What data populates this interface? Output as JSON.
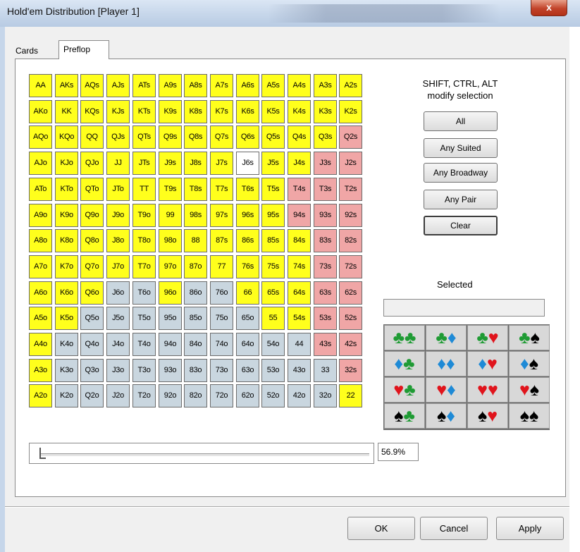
{
  "window": {
    "title": "Hold'em Distribution [Player 1]",
    "close_label": "x"
  },
  "tabs": [
    {
      "label": "Cards"
    },
    {
      "label": "Preflop"
    }
  ],
  "grid": {
    "rows": [
      [
        "AA",
        "AKs",
        "AQs",
        "AJs",
        "ATs",
        "A9s",
        "A8s",
        "A7s",
        "A6s",
        "A5s",
        "A4s",
        "A3s",
        "A2s"
      ],
      [
        "AKo",
        "KK",
        "KQs",
        "KJs",
        "KTs",
        "K9s",
        "K8s",
        "K7s",
        "K6s",
        "K5s",
        "K4s",
        "K3s",
        "K2s"
      ],
      [
        "AQo",
        "KQo",
        "QQ",
        "QJs",
        "QTs",
        "Q9s",
        "Q8s",
        "Q7s",
        "Q6s",
        "Q5s",
        "Q4s",
        "Q3s",
        "Q2s"
      ],
      [
        "AJo",
        "KJo",
        "QJo",
        "JJ",
        "JTs",
        "J9s",
        "J8s",
        "J7s",
        "J6s",
        "J5s",
        "J4s",
        "J3s",
        "J2s"
      ],
      [
        "ATo",
        "KTo",
        "QTo",
        "JTo",
        "TT",
        "T9s",
        "T8s",
        "T7s",
        "T6s",
        "T5s",
        "T4s",
        "T3s",
        "T2s"
      ],
      [
        "A9o",
        "K9o",
        "Q9o",
        "J9o",
        "T9o",
        "99",
        "98s",
        "97s",
        "96s",
        "95s",
        "94s",
        "93s",
        "92s"
      ],
      [
        "A8o",
        "K8o",
        "Q8o",
        "J8o",
        "T8o",
        "98o",
        "88",
        "87s",
        "86s",
        "85s",
        "84s",
        "83s",
        "82s"
      ],
      [
        "A7o",
        "K7o",
        "Q7o",
        "J7o",
        "T7o",
        "97o",
        "87o",
        "77",
        "76s",
        "75s",
        "74s",
        "73s",
        "72s"
      ],
      [
        "A6o",
        "K6o",
        "Q6o",
        "J6o",
        "T6o",
        "96o",
        "86o",
        "76o",
        "66",
        "65s",
        "64s",
        "63s",
        "62s"
      ],
      [
        "A5o",
        "K5o",
        "Q5o",
        "J5o",
        "T5o",
        "95o",
        "85o",
        "75o",
        "65o",
        "55",
        "54s",
        "53s",
        "52s"
      ],
      [
        "A4o",
        "K4o",
        "Q4o",
        "J4o",
        "T4o",
        "94o",
        "84o",
        "74o",
        "64o",
        "54o",
        "44",
        "43s",
        "42s"
      ],
      [
        "A3o",
        "K3o",
        "Q3o",
        "J3o",
        "T3o",
        "93o",
        "83o",
        "73o",
        "63o",
        "53o",
        "43o",
        "33",
        "32s"
      ],
      [
        "A2o",
        "K2o",
        "Q2o",
        "J2o",
        "T2o",
        "92o",
        "82o",
        "72o",
        "62o",
        "52o",
        "42o",
        "32o",
        "22"
      ]
    ],
    "states": [
      "yyyyyyyyyyyyy",
      "yyyyyyyyyyyyy",
      "yyyyyyyyyyyyr",
      "yyyyyyyywyyrr",
      "yyyyyyyyyyrrr",
      "yyyyyyyyyyrrr",
      "yyyyyyyyyyyrr",
      "yyyyyyyyyyyrr",
      "yyyggyggyyyrr",
      "yygggggggyyrr",
      "yggggggggggrr",
      "ygggggggggggr",
      "ygggggggggggy"
    ],
    "colors": {
      "y": "#ffff1c",
      "r": "#f0a6a6",
      "g": "#c9d6df",
      "w": "#ffffff"
    }
  },
  "help_text": [
    "SHIFT, CTRL, ALT",
    "modify selection"
  ],
  "buttons": {
    "all": "All",
    "any_suited": "Any Suited",
    "any_broadway": "Any Broadway",
    "any_pair": "Any Pair",
    "clear": "Clear"
  },
  "selected": {
    "label": "Selected",
    "value": ""
  },
  "suit_grid": [
    [
      [
        "♣",
        "g"
      ],
      [
        "♣",
        "g"
      ]
    ],
    [
      [
        "♣",
        "g"
      ],
      [
        "♦",
        "b"
      ]
    ],
    [
      [
        "♣",
        "g"
      ],
      [
        "♥",
        "r"
      ]
    ],
    [
      [
        "♣",
        "g"
      ],
      [
        "♠",
        "k"
      ]
    ],
    [
      [
        "♦",
        "b"
      ],
      [
        "♣",
        "g"
      ]
    ],
    [
      [
        "♦",
        "b"
      ],
      [
        "♦",
        "b"
      ]
    ],
    [
      [
        "♦",
        "b"
      ],
      [
        "♥",
        "r"
      ]
    ],
    [
      [
        "♦",
        "b"
      ],
      [
        "♠",
        "k"
      ]
    ],
    [
      [
        "♥",
        "r"
      ],
      [
        "♣",
        "g"
      ]
    ],
    [
      [
        "♥",
        "r"
      ],
      [
        "♦",
        "b"
      ]
    ],
    [
      [
        "♥",
        "r"
      ],
      [
        "♥",
        "r"
      ]
    ],
    [
      [
        "♥",
        "r"
      ],
      [
        "♠",
        "k"
      ]
    ],
    [
      [
        "♠",
        "k"
      ],
      [
        "♣",
        "g"
      ]
    ],
    [
      [
        "♠",
        "k"
      ],
      [
        "♦",
        "b"
      ]
    ],
    [
      [
        "♠",
        "k"
      ],
      [
        "♥",
        "r"
      ]
    ],
    [
      [
        "♠",
        "k"
      ],
      [
        "♠",
        "k"
      ]
    ]
  ],
  "slider": {
    "value_label": "56.9%"
  },
  "footer": {
    "ok": "OK",
    "cancel": "Cancel",
    "apply": "Apply"
  }
}
